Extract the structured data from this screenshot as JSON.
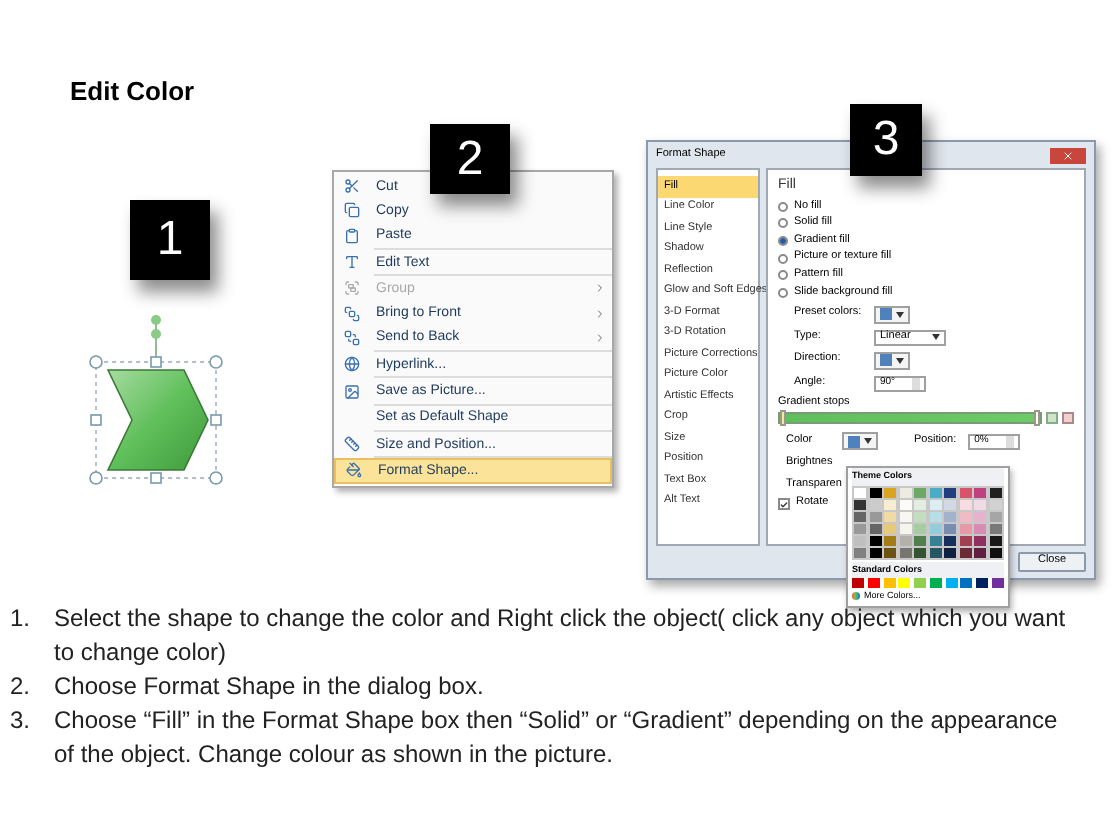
{
  "title": "Edit Color",
  "steps": [
    {
      "number": "1"
    },
    {
      "number": "2"
    },
    {
      "number": "3"
    }
  ],
  "context_menu": {
    "items": [
      {
        "label": "Cut",
        "disabled": false,
        "submenu": false,
        "selected": false
      },
      {
        "label": "Copy",
        "disabled": false,
        "submenu": false,
        "selected": false
      },
      {
        "label": "Paste",
        "disabled": false,
        "submenu": false,
        "selected": false
      },
      {
        "label": "Edit Text",
        "disabled": false,
        "submenu": false,
        "selected": false
      },
      {
        "label": "Group",
        "disabled": true,
        "submenu": true,
        "selected": false
      },
      {
        "label": "Bring to Front",
        "disabled": false,
        "submenu": true,
        "selected": false
      },
      {
        "label": "Send to Back",
        "disabled": false,
        "submenu": true,
        "selected": false
      },
      {
        "label": "Hyperlink...",
        "disabled": false,
        "submenu": false,
        "selected": false
      },
      {
        "label": "Save as Picture...",
        "disabled": false,
        "submenu": false,
        "selected": false
      },
      {
        "label": "Set as Default Shape",
        "disabled": false,
        "submenu": false,
        "selected": false
      },
      {
        "label": "Size and Position...",
        "disabled": false,
        "submenu": false,
        "selected": false
      },
      {
        "label": "Format Shape...",
        "disabled": false,
        "submenu": false,
        "selected": true
      }
    ]
  },
  "format_shape": {
    "title": "Format Shape",
    "categories": [
      {
        "label": "Fill",
        "selected": true
      },
      {
        "label": "Line Color",
        "selected": false
      },
      {
        "label": "Line Style",
        "selected": false
      },
      {
        "label": "Shadow",
        "selected": false
      },
      {
        "label": "Reflection",
        "selected": false
      },
      {
        "label": "Glow and Soft Edges",
        "selected": false
      },
      {
        "label": "3-D Format",
        "selected": false
      },
      {
        "label": "3-D Rotation",
        "selected": false
      },
      {
        "label": "Picture Corrections",
        "selected": false
      },
      {
        "label": "Picture Color",
        "selected": false
      },
      {
        "label": "Artistic Effects",
        "selected": false
      },
      {
        "label": "Crop",
        "selected": false
      },
      {
        "label": "Size",
        "selected": false
      },
      {
        "label": "Position",
        "selected": false
      },
      {
        "label": "Text Box",
        "selected": false
      },
      {
        "label": "Alt Text",
        "selected": false
      }
    ],
    "heading": "Fill",
    "fill_options": [
      {
        "label": "No fill",
        "selected": false
      },
      {
        "label": "Solid fill",
        "selected": false
      },
      {
        "label": "Gradient fill",
        "selected": true
      },
      {
        "label": "Picture or texture fill",
        "selected": false
      },
      {
        "label": "Pattern fill",
        "selected": false
      },
      {
        "label": "Slide background fill",
        "selected": false
      }
    ],
    "preset_label": "Preset colors:",
    "type_label": "Type:",
    "type_value": "Linear",
    "direction_label": "Direction:",
    "angle_label": "Angle:",
    "angle_value": "90°",
    "stops_label": "Gradient stops",
    "gradient_stops": [
      {
        "level": 0,
        "selected": true
      },
      {
        "level": 1,
        "selected": false
      }
    ],
    "color_label": "Color",
    "position_label": "Position:",
    "position_value": "0%",
    "brightness_label": "Brightnes",
    "transparency_label": "Transparen",
    "rotate_label": "Rotate",
    "rotate_checked": true,
    "close_button": "Close"
  },
  "color_menu": {
    "theme_heading": "Theme Colors",
    "theme_colors": [
      {
        "color": "#ffffff"
      },
      {
        "color": "#000000"
      },
      {
        "color": "#d9a520"
      },
      {
        "color": "#eeece1"
      },
      {
        "color": "#6aaa64"
      },
      {
        "color": "#4bacc6"
      },
      {
        "color": "#1f3f7f"
      },
      {
        "color": "#d9546b"
      },
      {
        "color": "#c04080"
      },
      {
        "color": "#202020"
      }
    ],
    "standard_heading": "Standard Colors",
    "standard_colors": [
      {
        "color": "#c00000"
      },
      {
        "color": "#ff0000"
      },
      {
        "color": "#ffc000"
      },
      {
        "color": "#ffff00"
      },
      {
        "color": "#92d050"
      },
      {
        "color": "#00b050"
      },
      {
        "color": "#00b0f0"
      },
      {
        "color": "#0070c0"
      },
      {
        "color": "#002060"
      },
      {
        "color": "#7030a0"
      }
    ],
    "more_colors": "More Colors..."
  },
  "instructions": [
    {
      "number": "1.",
      "text": "Select the shape to change the color and Right click the object( click any object which you want to change color)"
    },
    {
      "number": "2.",
      "text": "Choose Format Shape in the dialog box."
    },
    {
      "number": "3.",
      "text": "Choose “Fill” in the Format Shape box then “Solid” or “Gradient” depending on the appearance of the object. Change colour as shown in the picture."
    }
  ]
}
